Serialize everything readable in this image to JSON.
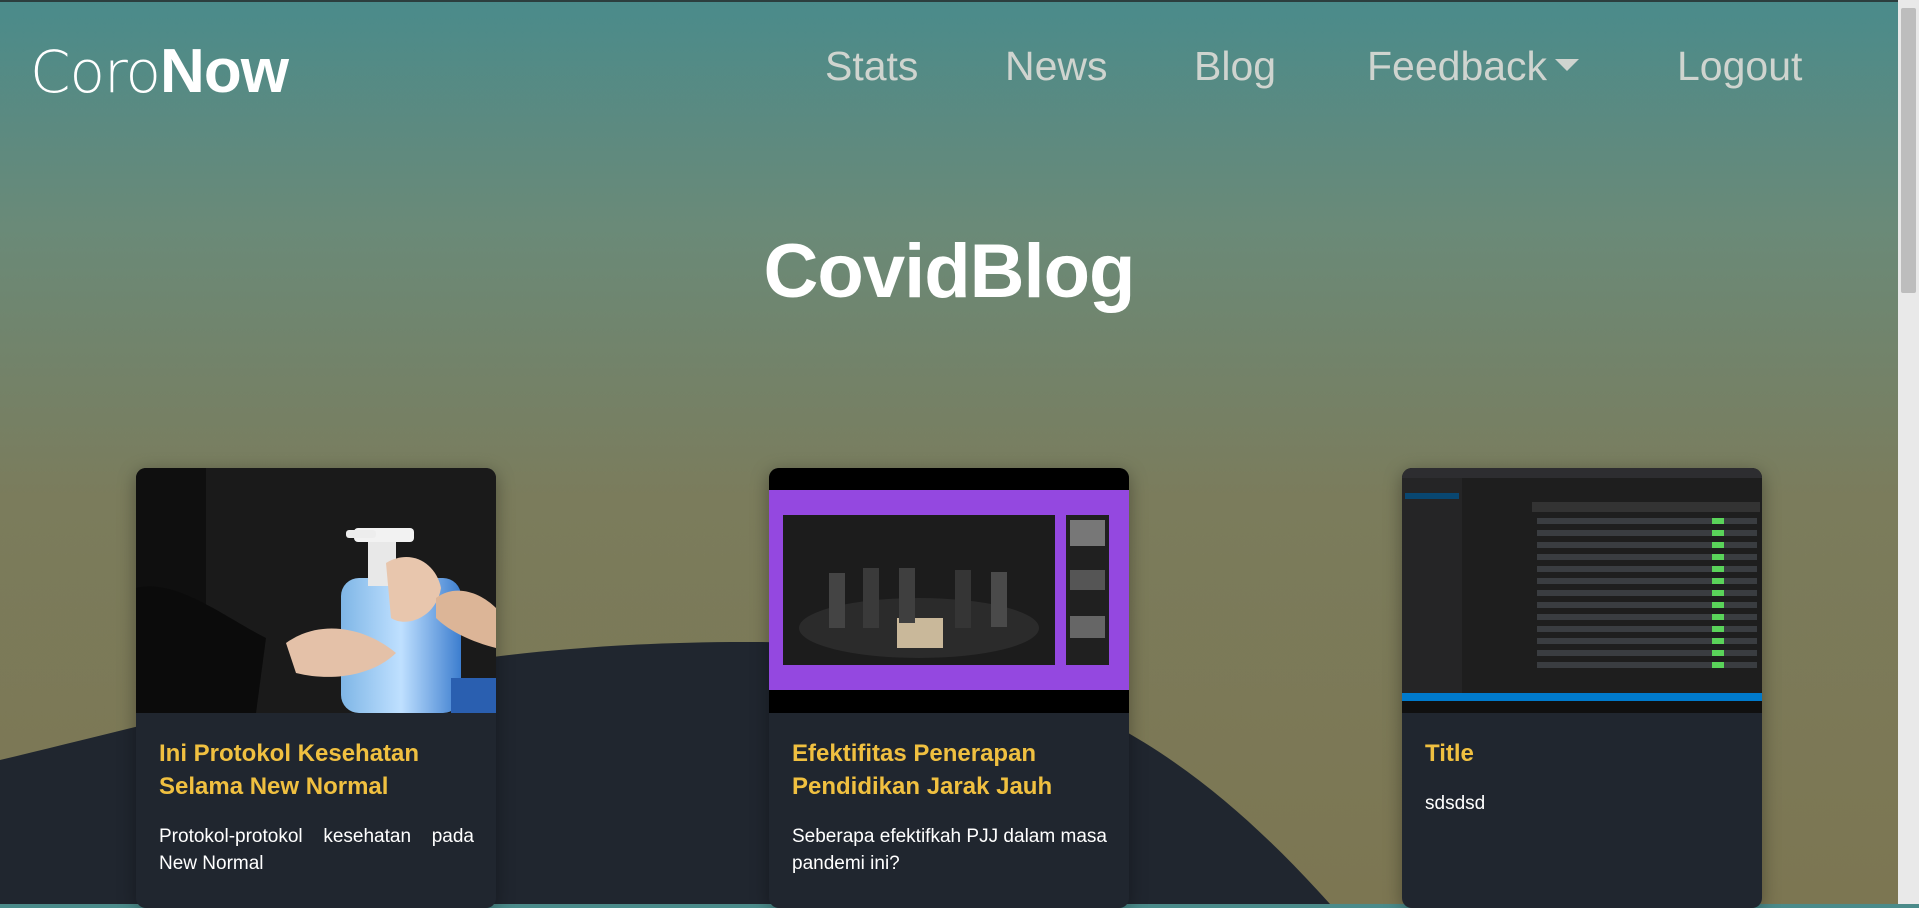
{
  "brand": {
    "light": "Coro",
    "bold": "Now"
  },
  "nav": {
    "stats": "Stats",
    "news": "News",
    "blog": "Blog",
    "feedback": "Feedback",
    "logout": "Logout"
  },
  "page_title": "CovidBlog",
  "cards": [
    {
      "title": "Ini Protokol Kesehatan Selama New Normal",
      "text": "Protokol-protokol kesehatan pada New Normal"
    },
    {
      "title": "Efektifitas Penerapan Pendidikan Jarak Jauh",
      "text": "Seberapa efektifkah PJJ dalam masa pandemi ini?"
    },
    {
      "title": "Title",
      "text": "sdsdsd"
    }
  ],
  "colors": {
    "accent_title": "#f0c040",
    "card_bg": "#20262f",
    "wave": "#20262f"
  }
}
